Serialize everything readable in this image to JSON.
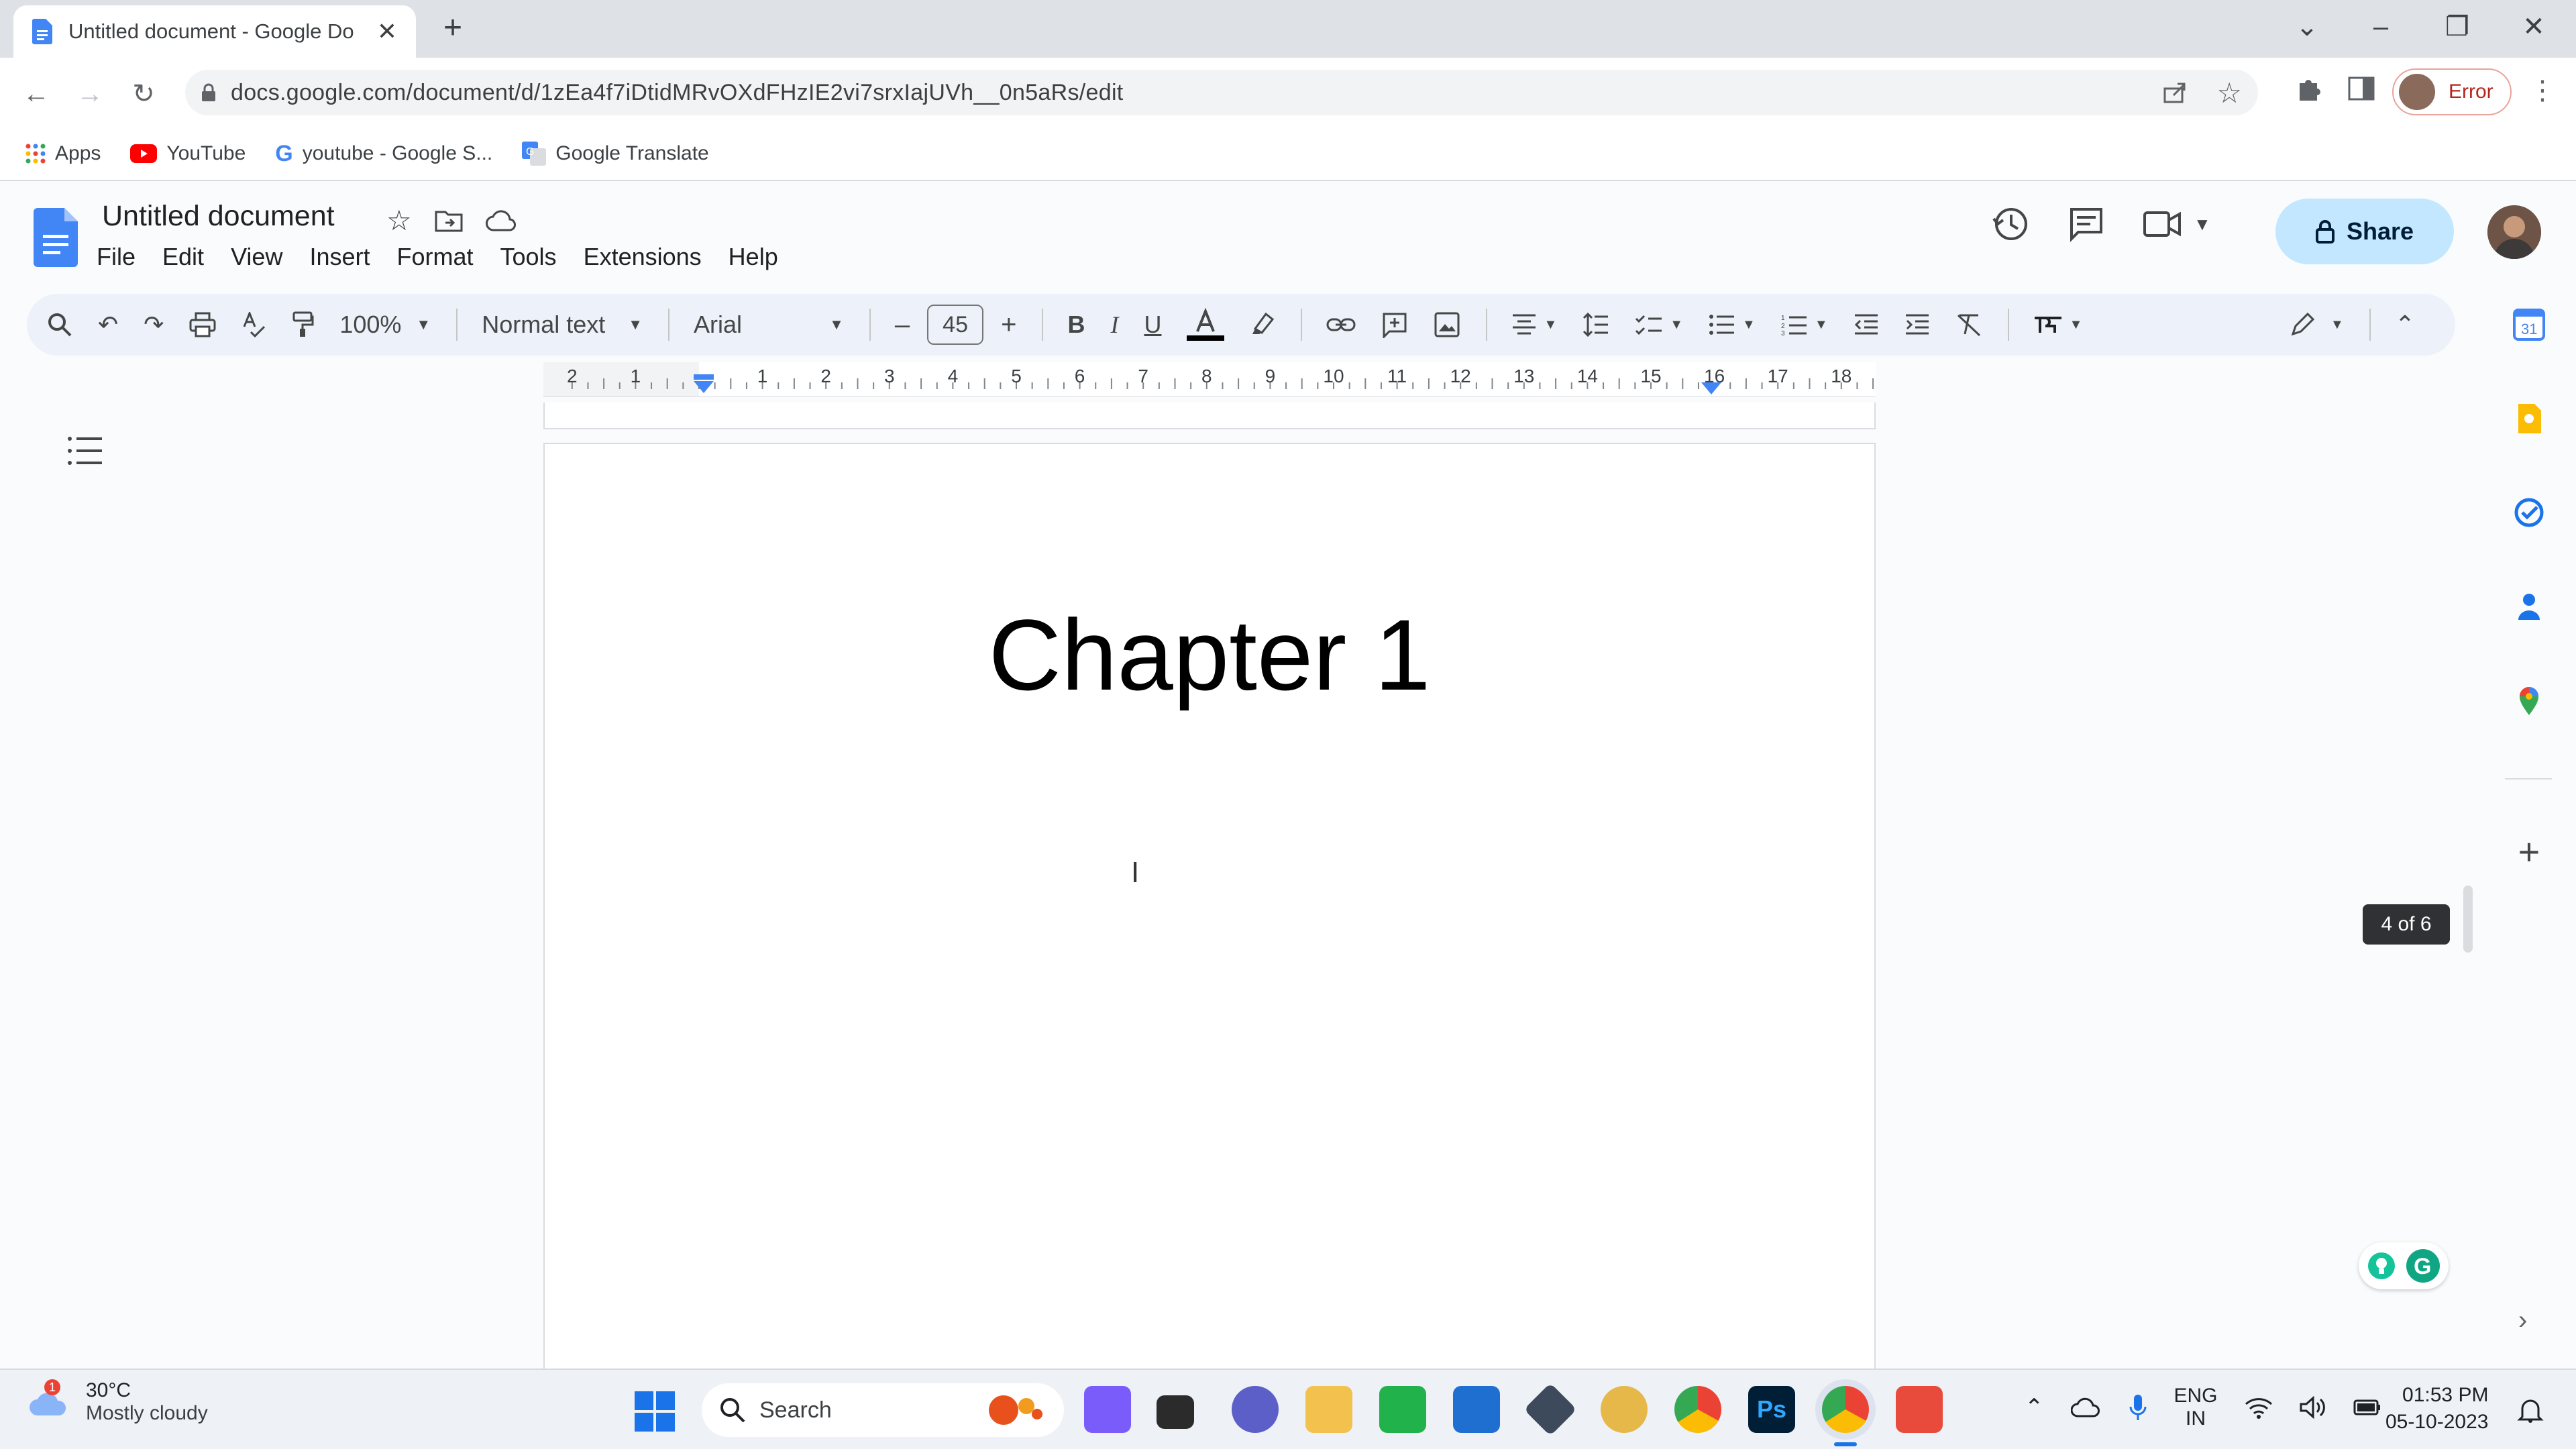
{
  "browser": {
    "tab_title": "Untitled document - Google Do",
    "new_tab": "+",
    "url": "docs.google.com/document/d/1zEa4f7iDtidMRvOXdFHzIE2vi7srxIajUVh__0n5aRs/edit",
    "profile_status": "Error",
    "bookmarks": [
      "Apps",
      "YouTube",
      "youtube - Google S...",
      "Google Translate"
    ]
  },
  "docs": {
    "title": "Untitled document",
    "menu": [
      "File",
      "Edit",
      "View",
      "Insert",
      "Format",
      "Tools",
      "Extensions",
      "Help"
    ],
    "share_label": "Share",
    "toolbar": {
      "zoom": "100%",
      "style": "Normal text",
      "font": "Arial",
      "font_size": "45"
    },
    "ruler_labels": [
      "2",
      "1",
      "1",
      "2",
      "3",
      "4",
      "5",
      "6",
      "7",
      "8",
      "9",
      "10",
      "11",
      "12",
      "13",
      "14",
      "15",
      "16",
      "17",
      "18"
    ],
    "heading": "Chapter 1",
    "page_indicator": "4 of 6"
  },
  "taskbar": {
    "weather_badge": "1",
    "temperature": "30°C",
    "weather": "Mostly cloudy",
    "search_label": "Search",
    "language": "ENG",
    "region": "IN",
    "time": "01:53 PM",
    "date": "05-10-2023"
  },
  "colors": {
    "docs_blue": "#4285f4",
    "share_bg": "#c2e7ff",
    "toolbar_bg": "#edf2fa",
    "error": "#b3261e"
  }
}
